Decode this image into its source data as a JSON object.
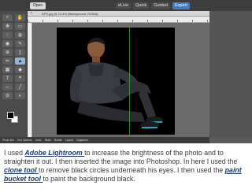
{
  "menubar": {
    "open_label": "Open",
    "tabs": [
      "eLive",
      "Quick",
      "Guided",
      "Expert"
    ],
    "active_tab": "Expert"
  },
  "document": {
    "title": "DFS.jpg @ 13.4% (Background, RGB/8)"
  },
  "tools": {
    "icons": [
      "zoom-icon",
      "hand-icon",
      "move-icon",
      "marquee-icon",
      "lasso-icon",
      "quick-select-icon",
      "red-eye-icon",
      "spot-heal-icon",
      "clone-stamp-icon",
      "eraser-icon",
      "brush-icon",
      "bucket-icon",
      "gradient-icon",
      "shape-icon",
      "text-icon",
      "crop-icon",
      "recompose-icon",
      "straighten-icon",
      "eyedropper-icon",
      "blur-icon"
    ],
    "glyphs": [
      "⌕",
      "✋",
      "✥",
      "▭",
      "◌",
      "◍",
      "◉",
      "✎",
      "⊕",
      "▯",
      "✏",
      "▲",
      "▦",
      "◆",
      "T",
      "⌗",
      "⇔",
      "╱",
      "⊘",
      "◐"
    ],
    "selected_index": 11,
    "foreground_color": "#000000",
    "background_color": "#ffffff"
  },
  "bottombar": {
    "items": [
      "Photo Bin",
      "Tool Options",
      "Undo",
      "Redo",
      "Rotate",
      "Layout",
      "Organizer"
    ]
  },
  "caption": {
    "p1": "I used ",
    "k1": "Adobe Lightroom ",
    "p2": "to increase the brightness of the photo and to straighten it out. I then inserted the image into Photoshop. In here I used the ",
    "k2": "clone tool ",
    "p3": "to remove black circles underneath his eyes. I then used the ",
    "k3": "paint bucket tool ",
    "p4": "to paint the background black."
  },
  "colors": {
    "keyword": "#1f3a6a",
    "accent_tab": "#3f7fc0",
    "canvas_bg": "#000000"
  }
}
